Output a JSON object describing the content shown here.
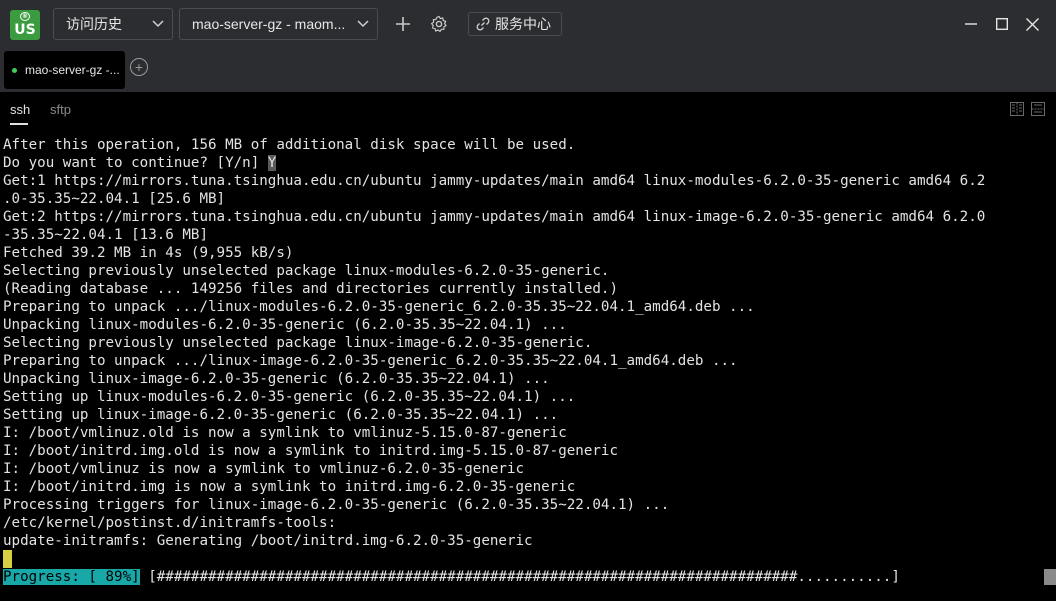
{
  "titlebar": {
    "logo_text": "US",
    "history_dropdown": "访问历史",
    "server_dropdown": "mao-server-gz - maom...",
    "service_center": "服务中心",
    "icons": [
      "plus-icon",
      "gear-icon",
      "link-icon",
      "minimize-icon",
      "maximize-icon",
      "close-icon"
    ]
  },
  "tabs": {
    "active_tab": "mao-server-gz -...",
    "status_color": "#3ecf5a"
  },
  "subtabs": {
    "ssh": "ssh",
    "sftp": "sftp"
  },
  "terminal": {
    "lines": [
      "After this operation, 156 MB of additional disk space will be used.",
      "Do you want to continue? [Y/n] ",
      "Get:1 https://mirrors.tuna.tsinghua.edu.cn/ubuntu jammy-updates/main amd64 linux-modules-6.2.0-35-generic amd64 6.2",
      ".0-35.35~22.04.1 [25.6 MB]",
      "Get:2 https://mirrors.tuna.tsinghua.edu.cn/ubuntu jammy-updates/main amd64 linux-image-6.2.0-35-generic amd64 6.2.0",
      "-35.35~22.04.1 [13.6 MB]",
      "Fetched 39.2 MB in 4s (9,955 kB/s)",
      "Selecting previously unselected package linux-modules-6.2.0-35-generic.",
      "(Reading database ... 149256 files and directories currently installed.)",
      "Preparing to unpack .../linux-modules-6.2.0-35-generic_6.2.0-35.35~22.04.1_amd64.deb ...",
      "Unpacking linux-modules-6.2.0-35-generic (6.2.0-35.35~22.04.1) ...",
      "Selecting previously unselected package linux-image-6.2.0-35-generic.",
      "Preparing to unpack .../linux-image-6.2.0-35-generic_6.2.0-35.35~22.04.1_amd64.deb ...",
      "Unpacking linux-image-6.2.0-35-generic (6.2.0-35.35~22.04.1) ...",
      "Setting up linux-modules-6.2.0-35-generic (6.2.0-35.35~22.04.1) ...",
      "Setting up linux-image-6.2.0-35-generic (6.2.0-35.35~22.04.1) ...",
      "I: /boot/vmlinuz.old is now a symlink to vmlinuz-5.15.0-87-generic",
      "I: /boot/initrd.img.old is now a symlink to initrd.img-5.15.0-87-generic",
      "I: /boot/vmlinuz is now a symlink to vmlinuz-6.2.0-35-generic",
      "I: /boot/initrd.img is now a symlink to initrd.img-6.2.0-35-generic",
      "Processing triggers for linux-image-6.2.0-35-generic (6.2.0-35.35~22.04.1) ...",
      "/etc/kernel/postinst.d/initramfs-tools:",
      "update-initramfs: Generating /boot/initrd.img-6.2.0-35-generic"
    ],
    "typed_answer": "Y",
    "progress_label": "Progress: [ 89%]",
    "progress_bar": "[###########################################################################...........]",
    "progress_percent": 89
  }
}
